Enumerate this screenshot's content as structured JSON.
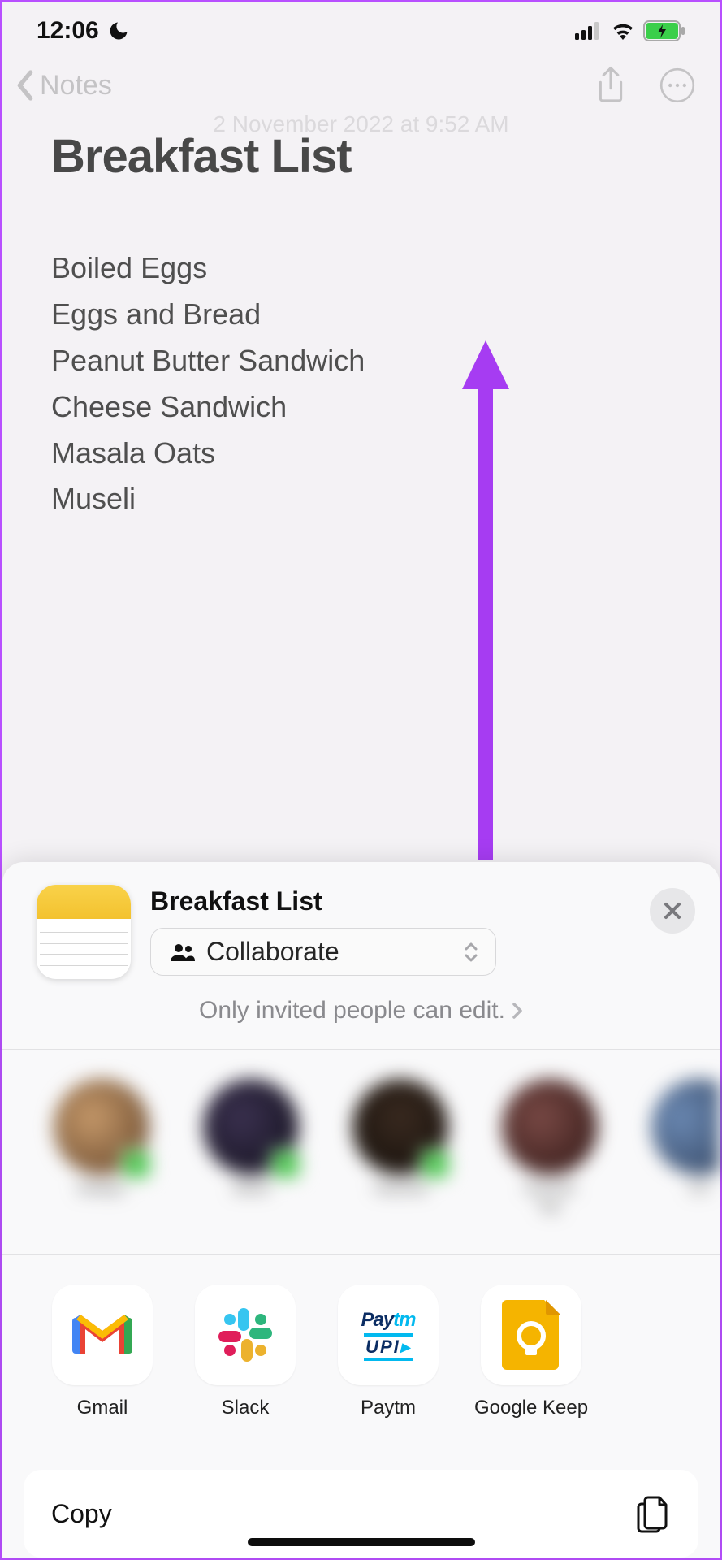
{
  "status": {
    "time": "12:06",
    "dnd_icon": "moon-icon"
  },
  "nav": {
    "back_label": "Notes",
    "date_text": "2 November 2022 at 9:52 AM"
  },
  "note": {
    "title": "Breakfast List",
    "items": [
      "Boiled Eggs",
      "Eggs and Bread",
      "Peanut Butter Sandwich",
      "Cheese Sandwich",
      "Masala Oats",
      "Museli"
    ]
  },
  "share": {
    "title": "Breakfast List",
    "collab_label": "Collaborate",
    "permission_text": "Only invited people can edit.",
    "apps": [
      {
        "name": "Gmail",
        "icon": "gmail-icon"
      },
      {
        "name": "Slack",
        "icon": "slack-icon"
      },
      {
        "name": "Paytm",
        "icon": "paytm-icon"
      },
      {
        "name": "Google Keep",
        "icon": "keep-icon"
      }
    ],
    "actions": {
      "copy_label": "Copy"
    }
  }
}
